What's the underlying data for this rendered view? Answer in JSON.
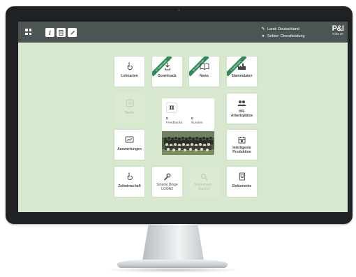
{
  "header": {
    "land_label": "Land: Deutschland",
    "sektor_label": "Sektor: Dienstleistung",
    "brand_logo": "P&I",
    "brand_sub": "PURE HR",
    "button_icons": [
      "info-icon",
      "document-icon",
      "pencil-icon"
    ]
  },
  "tiles": {
    "lohnarten": {
      "label": "Lohnarten",
      "icon": "hand-icon"
    },
    "downloads": {
      "label": "Downloads",
      "icon": "download-icon",
      "badge": "47 Änderungen"
    },
    "news": {
      "label": "News",
      "icon": "book-icon",
      "badge": "34 Änderungen"
    },
    "stammdaten": {
      "label": "Stammdaten",
      "icon": "factory-icon",
      "badge": "5 Änderungen"
    },
    "tarife": {
      "label": "Tarife",
      "icon": "percent-icon",
      "disabled": true
    },
    "arbeitsplaetze": {
      "label": "HR-\nArbeitsplätze",
      "icon": "people-icon"
    },
    "auswertungen": {
      "label": "Auswertungen",
      "icon": "chart-icon"
    },
    "intelligente_produktion": {
      "label": "Intelligente\nProduktion",
      "icon": "calendar-icon"
    },
    "zeitwirtschaft": {
      "label": "Zeitwirtschaft",
      "icon": "hand-icon"
    },
    "smarte_dinge": {
      "label": "Smarte Dinge\nLOGA3",
      "icon": "wrench-icon"
    },
    "selektionen": {
      "label": "Selektionen /\nSuchen",
      "icon": "search-icon",
      "disabled": true
    },
    "dokumente": {
      "label": "Dokumente",
      "icon": "document-icon"
    }
  },
  "center": {
    "symbol": "π",
    "feedbacks_count": "0",
    "feedbacks_label": "Feedbacks",
    "kunden_count": "0",
    "kunden_label": "Kunden"
  },
  "colors": {
    "topbar": "#4d5554",
    "screen_bg": "#d8e8cf",
    "badge": "#2f8a57",
    "bezel": "#1f2224"
  }
}
